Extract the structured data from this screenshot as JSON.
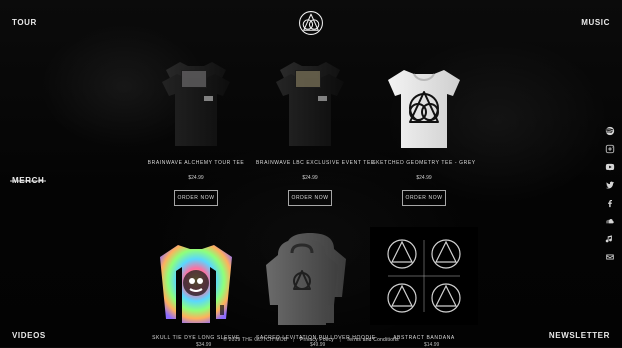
{
  "nav": {
    "top_left": "TOUR",
    "top_right": "MUSIC",
    "mid_left": "MERCH",
    "bottom_left": "VIDEOS",
    "bottom_right": "NEWSLETTER"
  },
  "products": [
    {
      "title": "BRAINWAVE ALCHEMY TOUR TEE",
      "price": "$24.99",
      "cta": "ORDER NOW"
    },
    {
      "title": "BRAINWAVE LBC EXCLUSIVE EVENT TEE",
      "price": "$24.99",
      "cta": "ORDER NOW"
    },
    {
      "title": "SKETCHED GEOMETRY TEE - GREY",
      "price": "$24.99",
      "cta": "ORDER NOW"
    },
    {
      "title": "SKULL TIE DYE LONG SLEEVE",
      "price": "$34.99"
    },
    {
      "title": "SACRED LEVITATION PULLOVER HOODIE",
      "price": "$49.99"
    },
    {
      "title": "ABSTRACT BANDANA",
      "price": "$14.99"
    }
  ],
  "footer": {
    "copyright": "© 2019 THE GLITCH MOB",
    "privacy": "Privacy Policy",
    "terms": "Terms and Conditions"
  },
  "social_icons": [
    "spotify-icon",
    "instagram-icon",
    "youtube-icon",
    "twitter-icon",
    "facebook-icon",
    "soundcloud-icon",
    "itunes-icon",
    "email-icon"
  ]
}
